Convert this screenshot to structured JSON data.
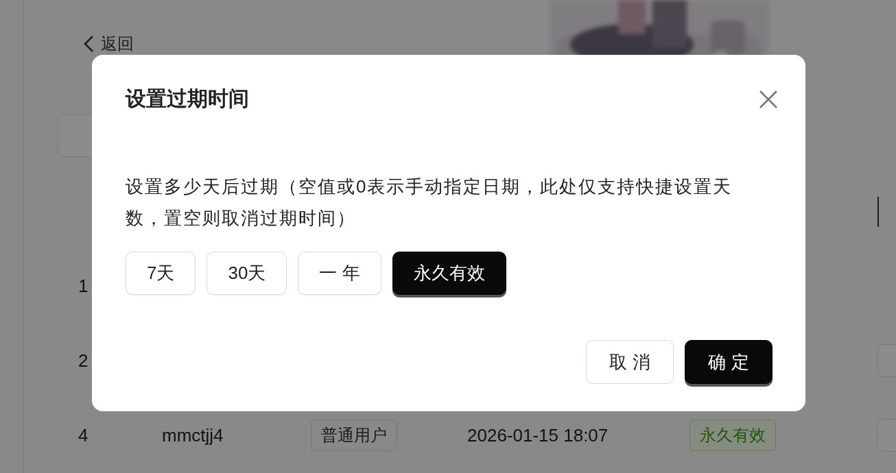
{
  "page": {
    "back_label": "返回"
  },
  "table": {
    "rows": [
      {
        "id": "1",
        "action_button": false
      },
      {
        "id": "2",
        "action_button": true
      },
      {
        "id": "4",
        "username": "mmctjj4",
        "role": "普通用户",
        "expires": "2026-01-15 18:07",
        "status": "永久有效",
        "action_button": true
      }
    ]
  },
  "dialog": {
    "title": "设置过期时间",
    "description": "设置多少天后过期（空值或0表示手动指定日期，此处仅支持快捷设置天数，置空则取消过期时间）",
    "presets": [
      {
        "label": "7天",
        "selected": false
      },
      {
        "label": "30天",
        "selected": false
      },
      {
        "label": "一 年",
        "selected": false
      },
      {
        "label": "永久有效",
        "selected": true
      }
    ],
    "buttons": [
      {
        "label": "取 消",
        "kind": "cancel"
      },
      {
        "label": "确 定",
        "kind": "primary"
      }
    ]
  }
}
